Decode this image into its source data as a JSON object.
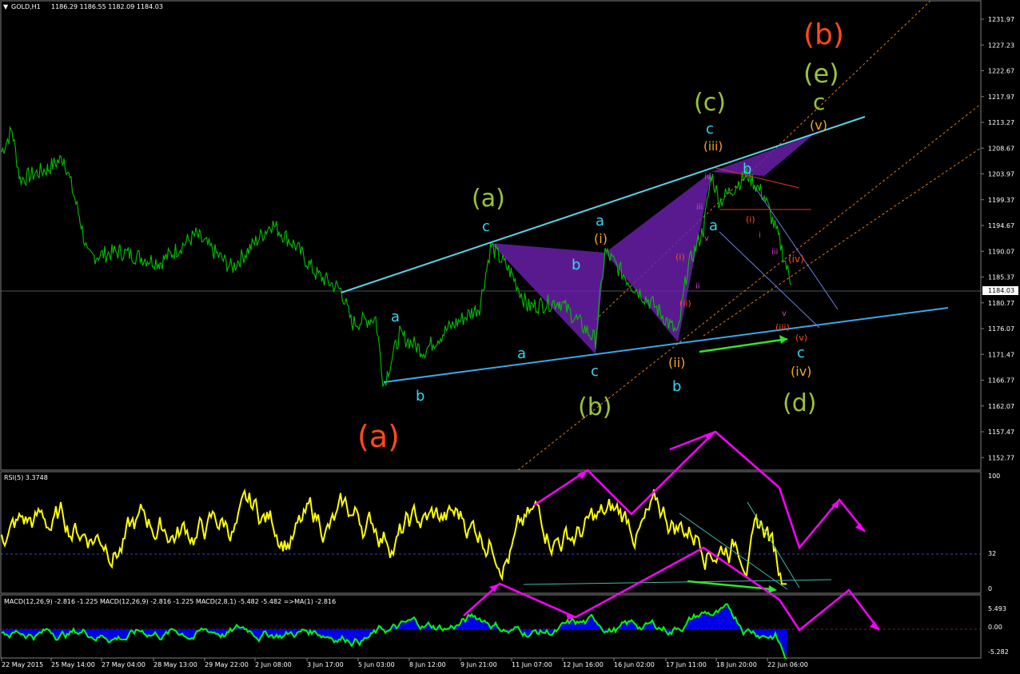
{
  "header": {
    "symbol_label": "GOLD,H1",
    "ohlc_label": "1186.29 1186.55 1182.09 1184.03"
  },
  "main_panel": {
    "price_axis": [
      "1231.97",
      "1227.23",
      "1222.67",
      "1217.97",
      "1213.27",
      "1208.67",
      "1203.97",
      "1199.37",
      "1194.67",
      "1190.07",
      "1185.37",
      "1180.77",
      "1176.07",
      "1171.47",
      "1166.77",
      "1162.07",
      "1157.47",
      "1152.77"
    ],
    "current_price": "1184.03"
  },
  "rsi_panel": {
    "label": "RSI(5) 3.3748",
    "levels": [
      "100",
      "32",
      "0"
    ]
  },
  "macd_panel": {
    "label": "MACD(12,26,9) -2.816 -1.225  MACD(12,26,9) -2.816 -1.225  MACD(2,8,1) -5.482 -5.482  =>MA(1) -2.816",
    "levels": [
      "5.493",
      "0.00",
      "-5.282"
    ]
  },
  "time_axis": [
    "22 May 2015",
    "25 May 14:00",
    "27 May 04:00",
    "28 May 13:00",
    "29 May 22:00",
    "2 Jun 08:00",
    "3 Jun 17:00",
    "5 Jun 03:00",
    "8 Jun 12:00",
    "9 Jun 21:00",
    "11 Jun 07:00",
    "12 Jun 16:00",
    "16 Jun 02:00",
    "17 Jun 11:00",
    "18 Jun 20:00",
    "22 Jun 06:00"
  ],
  "wave_labels": {
    "b_big": "(b)",
    "e_big": "(e)",
    "c_top_green": "c",
    "v_top": "(v)",
    "c_paren_green": "(c)",
    "c_cyan_top": "c",
    "iii_orange": "(iii)",
    "a_paren_green": "(a)",
    "c_cyan_left": "c",
    "a_cyan_mid": "a",
    "i_orange": "(i)",
    "b_cyan_mid": "b",
    "a_cyan_low": "a",
    "a_cyan_left": "a",
    "b_cyan_left": "b",
    "c_cyan_low": "c",
    "b_paren_green": "(b)",
    "a_paren_orange": "(a)",
    "ii_orange": "(ii)",
    "b_cyan_low": "b",
    "c_cyan_right": "c",
    "iv_orange": "(iv)",
    "d_paren_green": "(d)",
    "b_cyan_right": "b",
    "a_cyan_right": "a",
    "iv_paren_red": "(iv)",
    "iii_red": "(iii)",
    "v_red": "(v)",
    "i_red": "(i)",
    "ii_red": "(ii)",
    "i_paren_red2": "(i)",
    "iii_roman": "iii",
    "v_roman": "v",
    "ii_roman": "ii",
    "i_roman": "i",
    "iii_roman2": "iii",
    "i_roman2": "i",
    "iv_roman": "iv",
    "v_roman2": "v"
  },
  "colors": {
    "background": "#000000",
    "price_line": "#00c000",
    "rsi_line": "#ffff00",
    "macd_line": "#00ff00",
    "macd_hist": "#0000ff",
    "channel": "#5ad2e6",
    "pattern_fill": "#6a1fa8",
    "arrows": "#ff00ff",
    "fib_lines": "#e07a1e",
    "wave_green": "#9ac43a",
    "wave_cyan": "#3ad3f0",
    "wave_orange": "#f5a623",
    "wave_red": "#ff4a1a"
  },
  "chart_data": {
    "type": "line",
    "title": "GOLD,H1",
    "xlabel": "",
    "ylabel": "",
    "ylim": [
      1152.77,
      1231.97
    ],
    "x": [
      "22 May 2015",
      "25 May 14:00",
      "27 May 04:00",
      "28 May 13:00",
      "29 May 22:00",
      "2 Jun 08:00",
      "3 Jun 17:00",
      "5 Jun 03:00",
      "8 Jun 12:00",
      "9 Jun 21:00",
      "11 Jun 07:00",
      "12 Jun 16:00",
      "16 Jun 02:00",
      "17 Jun 11:00",
      "18 Jun 20:00",
      "22 Jun 06:00"
    ],
    "series": [
      {
        "name": "",
        "values": [
          1210,
          1205,
          1192,
          1192,
          1193,
          1196,
          1186,
          1168,
          1178,
          1190,
          1183,
          1180,
          1178,
          1188,
          1203,
          1184
        ]
      }
    ]
  }
}
